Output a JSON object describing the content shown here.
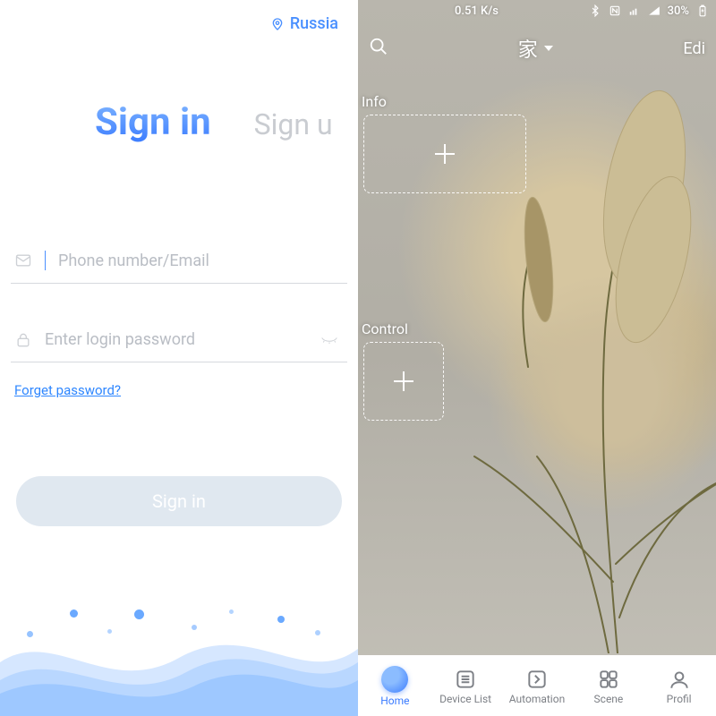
{
  "left": {
    "country": "Russia",
    "tabs": {
      "signin": "Sign in",
      "signup": "Sign u"
    },
    "fields": {
      "email_placeholder": "Phone number/Email",
      "password_placeholder": "Enter login password"
    },
    "forgot": "Forget password?",
    "signin_button": "Sign in"
  },
  "right": {
    "statusbar": {
      "speed": "0.51 K/s",
      "battery": "30%"
    },
    "topbar": {
      "title": "家",
      "edit": "Edi"
    },
    "sections": {
      "info": "Info",
      "control": "Control"
    },
    "nav": {
      "home": "Home",
      "device_list": "Device List",
      "automation": "Automation",
      "scene": "Scene",
      "profile": "Profil"
    }
  }
}
